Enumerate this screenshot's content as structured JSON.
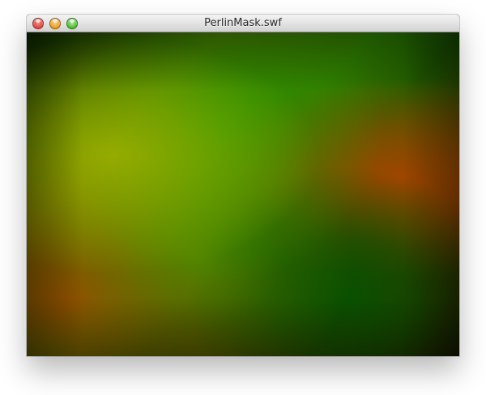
{
  "window": {
    "title": "PerlinMask.swf"
  },
  "controls": {
    "close": "close",
    "minimize": "minimize",
    "zoom": "zoom"
  },
  "content": {
    "type": "perlin-noise",
    "colors": {
      "green": "#2a9000",
      "yellow_green": "#9fb000",
      "orange": "#a95000",
      "dark_green": "#064d00",
      "black": "#000000"
    }
  }
}
